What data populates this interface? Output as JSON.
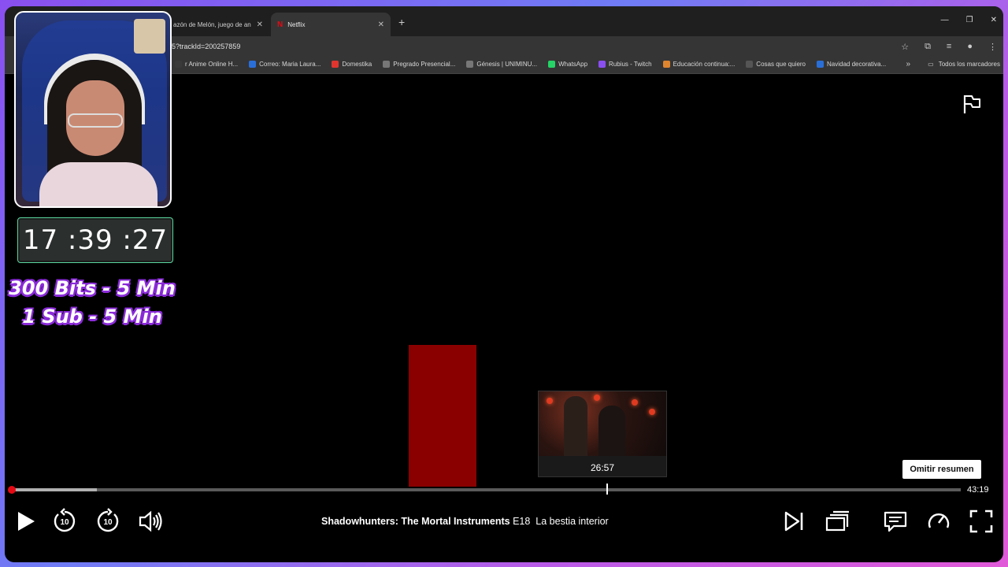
{
  "browser": {
    "tabs": [
      {
        "label": "azón de Melón, juego de an",
        "active": false
      },
      {
        "label": "Netflix",
        "active": true
      }
    ],
    "url": "5?trackId=200257859",
    "bookmarks": [
      {
        "label": "r Anime Online H...",
        "color": "#3a3a3a"
      },
      {
        "label": "Correo: Maria Laura...",
        "color": "#2a6fd8"
      },
      {
        "label": "Domestika",
        "color": "#e0352f"
      },
      {
        "label": "Pregrado Presencial...",
        "color": "#777777"
      },
      {
        "label": "Génesis | UNIMINU...",
        "color": "#777777"
      },
      {
        "label": "WhatsApp",
        "color": "#25d366"
      },
      {
        "label": "Rubius - Twitch",
        "color": "#8a4ff0"
      },
      {
        "label": "Educación continua:...",
        "color": "#e0852f"
      },
      {
        "label": "Cosas que quiero",
        "color": "#555555"
      },
      {
        "label": "Navidad decorativa...",
        "color": "#2a6fd8"
      }
    ],
    "all_bookmarks": "Todos los marcadores"
  },
  "player": {
    "preview_time": "26:57",
    "remaining_time": "43:19",
    "skip_recap": "Omitir resumen",
    "progress_played": 0.004,
    "progress_buffered": 0.09,
    "hover_position": 0.627,
    "show_title": "Shadowhunters: The Mortal Instruments",
    "episode_number": "E18",
    "episode_title": "La bestia interior",
    "accent_color": "#e50914"
  },
  "overlay": {
    "timer": "17 :39 :27",
    "line1": "300 Bits - 5 Min",
    "line2": "1 Sub - 5 Min"
  }
}
